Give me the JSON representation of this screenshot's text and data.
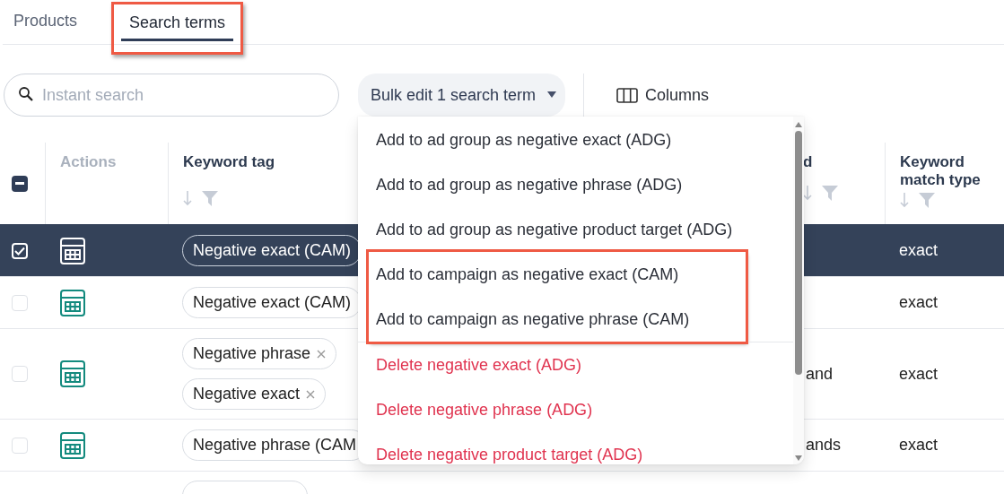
{
  "tabs": [
    {
      "label": "Products",
      "selected": false,
      "highlighted": false
    },
    {
      "label": "Search terms",
      "selected": true,
      "highlighted": true
    }
  ],
  "search": {
    "placeholder": "Instant search"
  },
  "bulk_edit": {
    "label": "Bulk edit 1 search term",
    "expanded": true
  },
  "columns_button": {
    "label": "Columns"
  },
  "table": {
    "select_all": {
      "indeterminate": true
    },
    "columns": [
      {
        "label": "Actions",
        "kind": "actions"
      },
      {
        "label": "Keyword tag",
        "kind": "tags"
      },
      {
        "label": "d",
        "kind": "text"
      },
      {
        "label": "Keyword match type",
        "kind": "text"
      }
    ],
    "rows": [
      {
        "selected": true,
        "tags": [
          {
            "label": "Negative exact (CAM)",
            "removable": false
          }
        ],
        "column_4": "",
        "match_type": "exact"
      },
      {
        "selected": false,
        "tags": [
          {
            "label": "Negative exact (CAM)",
            "removable": false
          }
        ],
        "column_4": "",
        "match_type": "exact"
      },
      {
        "selected": false,
        "tags": [
          {
            "label": "Negative phrase",
            "removable": true
          },
          {
            "label": "Negative exact",
            "removable": true
          }
        ],
        "column_4": "and",
        "match_type": "exact"
      },
      {
        "selected": false,
        "tags": [
          {
            "label": "Negative phrase (CAM",
            "removable": false
          }
        ],
        "column_4": "ands",
        "match_type": "exact"
      }
    ]
  },
  "menu": {
    "items": [
      {
        "label": "Add to ad group as negative exact (ADG)",
        "kind": "add",
        "highlighted": false
      },
      {
        "label": "Add to ad group as negative phrase (ADG)",
        "kind": "add",
        "highlighted": false
      },
      {
        "label": "Add to ad group as negative product target (ADG)",
        "kind": "add",
        "highlighted": false
      },
      {
        "label": "Add to campaign as negative exact (CAM)",
        "kind": "add",
        "highlighted": true
      },
      {
        "label": "Add to campaign as negative phrase (CAM)",
        "kind": "add",
        "highlighted": true
      },
      {
        "label": "Delete negative exact (ADG)",
        "kind": "delete",
        "highlighted": false
      },
      {
        "label": "Delete negative phrase (ADG)",
        "kind": "delete",
        "highlighted": false
      },
      {
        "label": "Delete negative product target (ADG)",
        "kind": "delete",
        "highlighted": false
      }
    ]
  }
}
